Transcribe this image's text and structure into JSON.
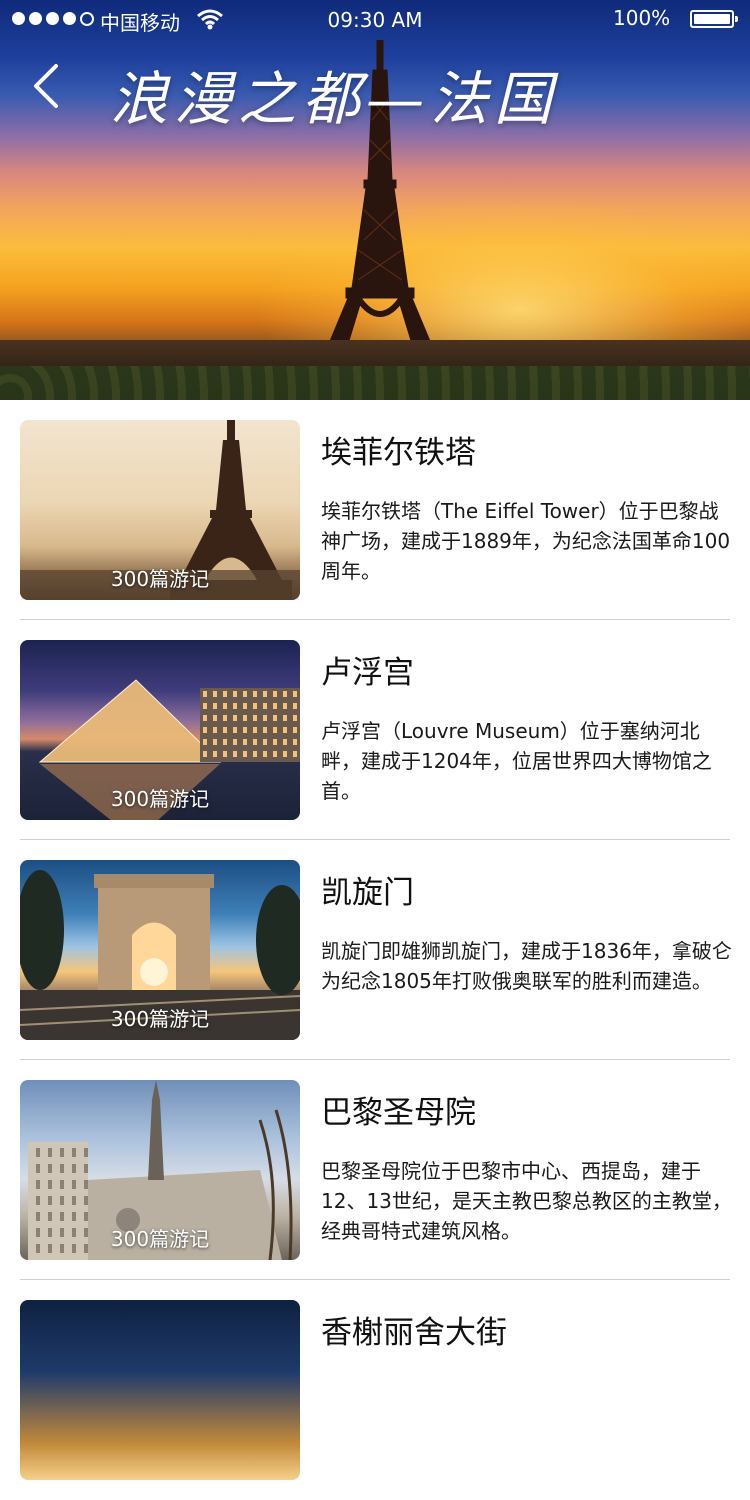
{
  "status_bar": {
    "carrier": "中国移动",
    "time": "09:30 AM",
    "battery": "100%"
  },
  "header": {
    "title": "浪漫之都—法国"
  },
  "places": [
    {
      "name": "埃菲尔铁塔",
      "count": "300篇游记",
      "description": "埃菲尔铁塔（The Eiffel Tower）位于巴黎战神广场，建成于1889年，为纪念法国革命100周年。"
    },
    {
      "name": "卢浮宫",
      "count": "300篇游记",
      "description": "卢浮宫（Louvre Museum）位于塞纳河北畔，建成于1204年，位居世界四大博物馆之首。"
    },
    {
      "name": "凯旋门",
      "count": "300篇游记",
      "description": "凯旋门即雄狮凯旋门，建成于1836年，拿破仑为纪念1805年打败俄奥联军的胜利而建造。"
    },
    {
      "name": "巴黎圣母院",
      "count": "300篇游记",
      "description": "巴黎圣母院位于巴黎市中心、西提岛，建于12、13世纪，是天主教巴黎总教区的主教堂，经典哥特式建筑风格。"
    },
    {
      "name": "香榭丽舍大街",
      "count": "",
      "description": ""
    }
  ]
}
